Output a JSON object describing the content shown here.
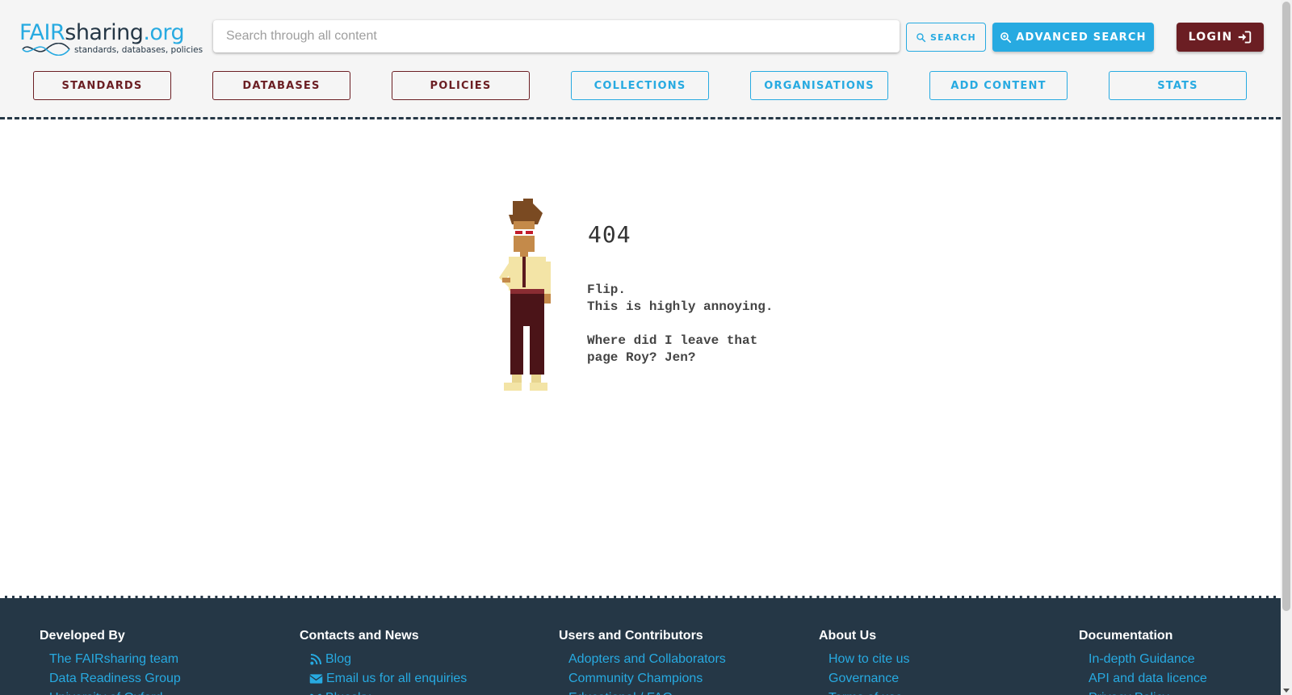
{
  "logo": {
    "part1": "FAIR",
    "part2": "sharing",
    "part3": ".org",
    "tagline": "standards, databases, policies"
  },
  "search": {
    "placeholder": "Search through all content",
    "value": ""
  },
  "buttons": {
    "search": "SEARCH",
    "advanced_search": "ADVANCED SEARCH",
    "login": "LOGIN"
  },
  "nav": [
    {
      "label": "STANDARDS"
    },
    {
      "label": "DATABASES"
    },
    {
      "label": "POLICIES"
    },
    {
      "label": "COLLECTIONS"
    },
    {
      "label": "ORGANISATIONS"
    },
    {
      "label": "ADD CONTENT"
    },
    {
      "label": "STATS"
    }
  ],
  "error": {
    "code": "404",
    "message": "Flip.\nThis is highly annoying.\n\nWhere did I leave that\npage Roy? Jen?"
  },
  "footer": {
    "columns": [
      {
        "title": "Developed By",
        "links": [
          "The FAIRsharing team",
          "Data Readiness Group",
          "University of Oxford"
        ]
      },
      {
        "title": "Contacts and News",
        "links": [
          "Blog",
          "Email us for all enquiries",
          "Bluesky"
        ]
      },
      {
        "title": "Users and Contributors",
        "links": [
          "Adopters and Collaborators",
          "Community Champions",
          "Educational / FAQ"
        ]
      },
      {
        "title": "About Us",
        "links": [
          "How to cite us",
          "Governance",
          "Terms of use"
        ]
      },
      {
        "title": "Documentation",
        "links": [
          "In-depth Guidance",
          "API and data licence",
          "Privacy Policy"
        ]
      }
    ]
  },
  "colors": {
    "primary_blue": "#27aae1",
    "dark_red": "#6b1e23",
    "navy": "#253746",
    "header_bg": "#f5f5f5"
  },
  "icons": {
    "search": "magnify-icon",
    "advanced_search": "magnify-plus-icon",
    "login": "login-icon",
    "blog": "rss-icon",
    "email": "envelope-icon"
  }
}
